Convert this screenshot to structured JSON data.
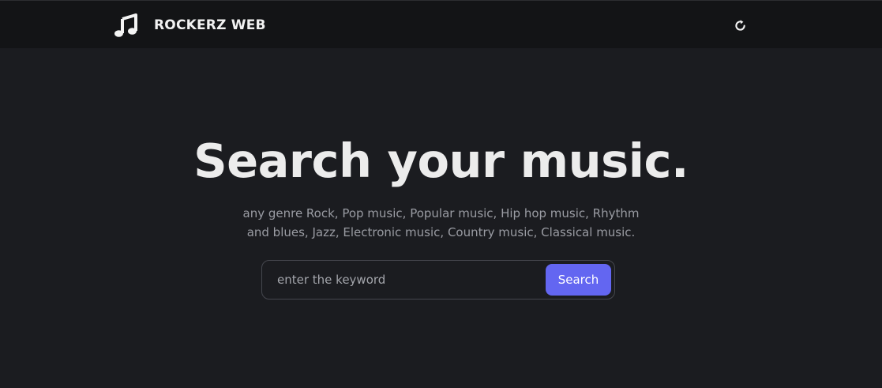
{
  "header": {
    "brand_icon": "music-note-icon",
    "brand_name": "ROCKERZ WEB",
    "refresh_icon": "refresh-icon",
    "refresh_glyph": "↻"
  },
  "hero": {
    "title": "Search your music.",
    "subtitle": "any genre Rock, Pop music, Popular music, Hip hop music, Rhythm and blues, Jazz, Electronic music, Country music, Classical music."
  },
  "search": {
    "placeholder": "enter the keyword",
    "value": "",
    "button_label": "Search"
  },
  "colors": {
    "background": "#1b1c20",
    "header_background": "#131416",
    "accent": "#6366f1",
    "subtitle_text": "#9a9ca3"
  }
}
